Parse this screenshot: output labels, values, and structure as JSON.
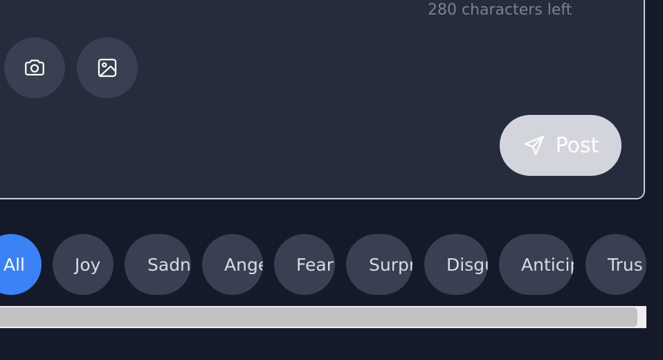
{
  "composer": {
    "char_count": "280 characters left",
    "post_label": "Post",
    "icons": {
      "camera": "camera-icon",
      "image": "image-icon",
      "send": "send-icon"
    }
  },
  "filters": {
    "chips": [
      {
        "label": "All",
        "active": true
      },
      {
        "label": "Joy",
        "active": false
      },
      {
        "label": "Sadne",
        "active": false
      },
      {
        "label": "Angei",
        "active": false
      },
      {
        "label": "Fear",
        "active": false
      },
      {
        "label": "Surpri",
        "active": false
      },
      {
        "label": "Disgus",
        "active": false
      },
      {
        "label": "Anticip",
        "active": false
      },
      {
        "label": "Trus",
        "active": false
      }
    ]
  },
  "colors": {
    "page_bg": "#141a27",
    "card_bg": "#252c3b",
    "chip_bg": "#394052",
    "accent": "#3b82f6"
  }
}
